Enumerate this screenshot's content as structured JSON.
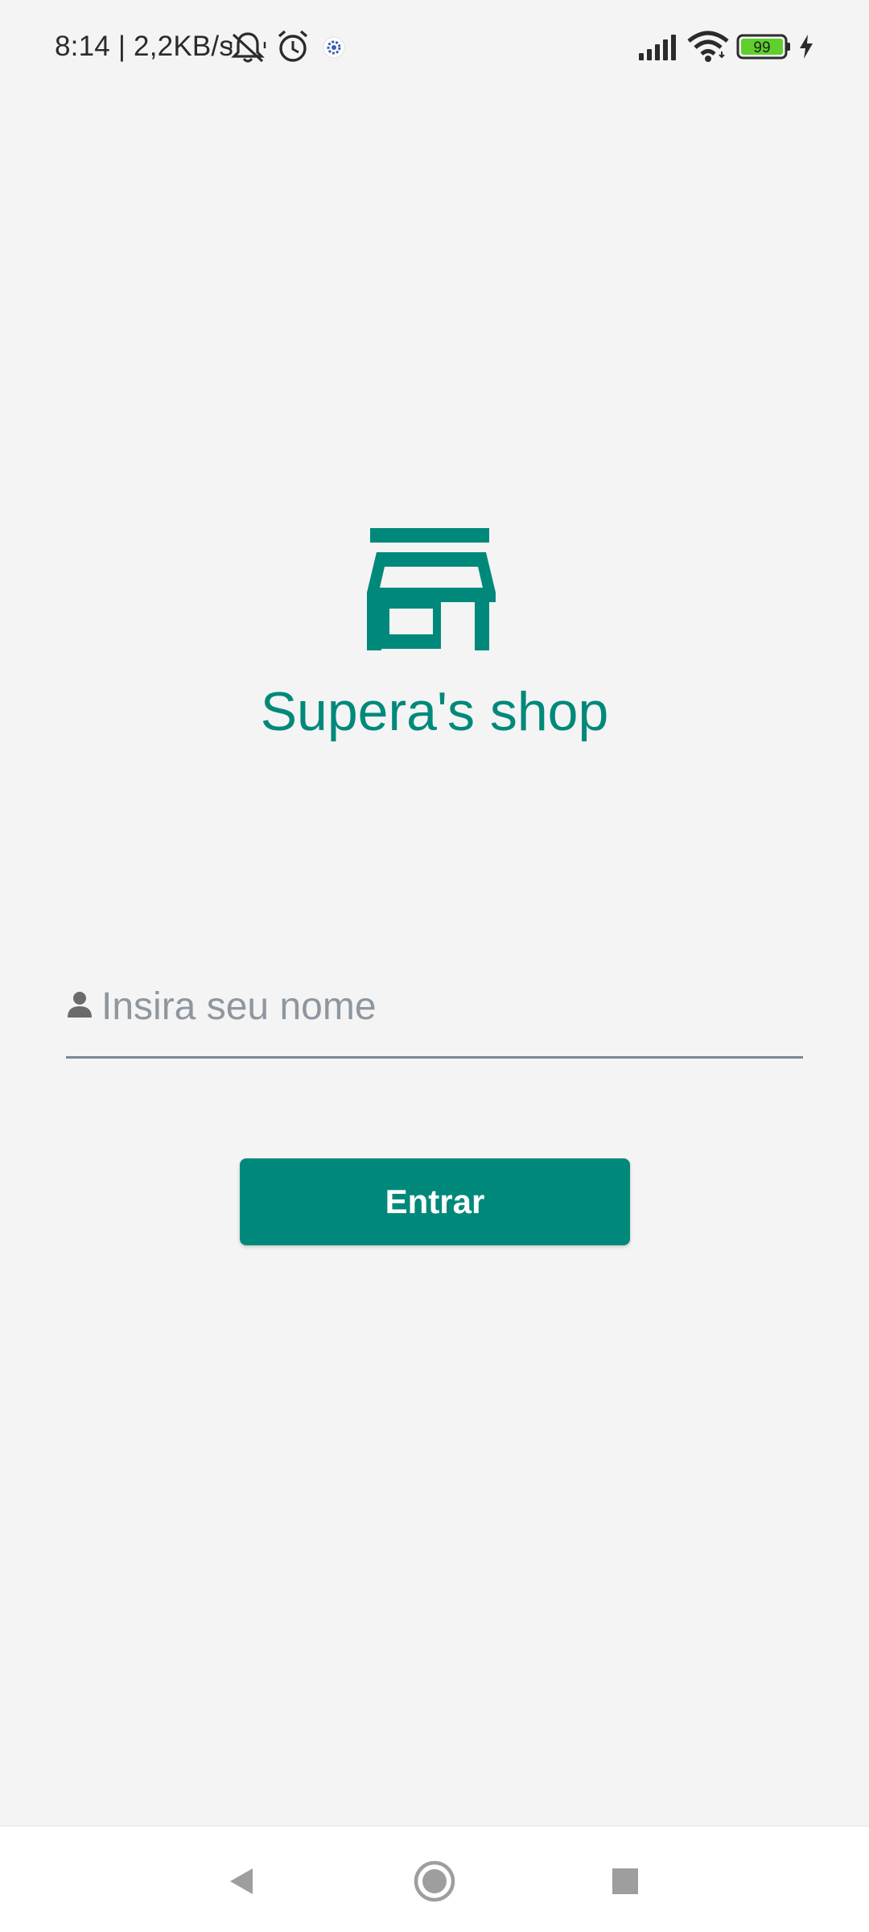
{
  "status_bar": {
    "time_and_speed": "8:14 | 2,2KB/s",
    "battery_level": "99",
    "icons": [
      "mute-bell-icon",
      "alarm-icon",
      "app-notification-icon",
      "signal-icon",
      "wifi-icon",
      "battery-icon",
      "charging-icon"
    ]
  },
  "app": {
    "logo_icon": "storefront-icon",
    "title": "Supera's shop",
    "accent_color": "#00897b"
  },
  "login_form": {
    "name_input": {
      "placeholder": "Insira seu nome",
      "value": "",
      "icon": "person-icon"
    },
    "submit_label": "Entrar"
  },
  "nav_bar": {
    "buttons": [
      "back-icon",
      "home-icon",
      "recents-icon"
    ]
  }
}
